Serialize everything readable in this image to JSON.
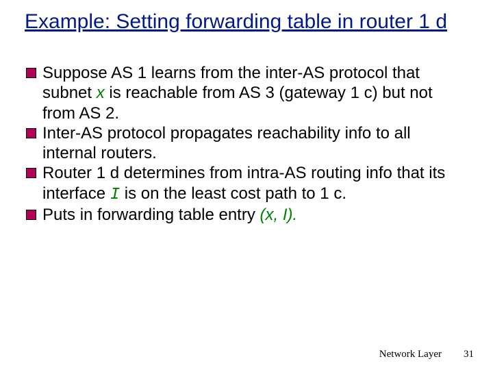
{
  "title": "Example: Setting forwarding table in router 1 d",
  "bullets": {
    "b1a": "Suppose AS 1 learns from the inter-AS protocol that subnet ",
    "b1x": "x",
    "b1b": " is reachable from AS 3 (gateway 1 c) but not from AS 2.",
    "b2": "Inter-AS protocol propagates reachability info to all internal routers.",
    "b3a": "Router 1 d determines from intra-AS routing info that its interface ",
    "b3i": "I",
    "b3b": "  is on the least cost path to 1 c.",
    "b4a": "Puts in forwarding table entry ",
    "b4p": "(x, I).",
    "b4b": ""
  },
  "footer": {
    "layer": "Network Layer",
    "page": "31"
  }
}
